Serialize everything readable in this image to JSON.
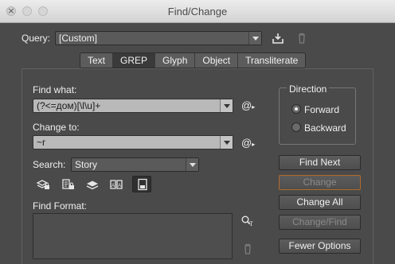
{
  "window": {
    "title": "Find/Change"
  },
  "query": {
    "label": "Query:",
    "value": "[Custom]"
  },
  "tabs": [
    {
      "label": "Text",
      "active": false
    },
    {
      "label": "GREP",
      "active": true
    },
    {
      "label": "Glyph",
      "active": false
    },
    {
      "label": "Object",
      "active": false
    },
    {
      "label": "Transliterate",
      "active": false
    }
  ],
  "find_what": {
    "label": "Find what:",
    "value": "(?<=дом)[\\l\\u]+"
  },
  "change_to": {
    "label": "Change to:",
    "value": "~r"
  },
  "search": {
    "label": "Search:",
    "value": "Story"
  },
  "find_format": {
    "label": "Find Format:"
  },
  "direction": {
    "title": "Direction",
    "options": [
      {
        "label": "Forward",
        "selected": true
      },
      {
        "label": "Backward",
        "selected": false
      }
    ]
  },
  "buttons": {
    "find_next": "Find Next",
    "change": "Change",
    "change_all": "Change All",
    "change_find": "Change/Find",
    "fewer_options": "Fewer Options"
  },
  "special_char_symbol": "@",
  "colors": {
    "focus_ring": "#b06b2a",
    "panel_bg": "#4a4a4a",
    "field_bg": "#b9b9b9"
  }
}
